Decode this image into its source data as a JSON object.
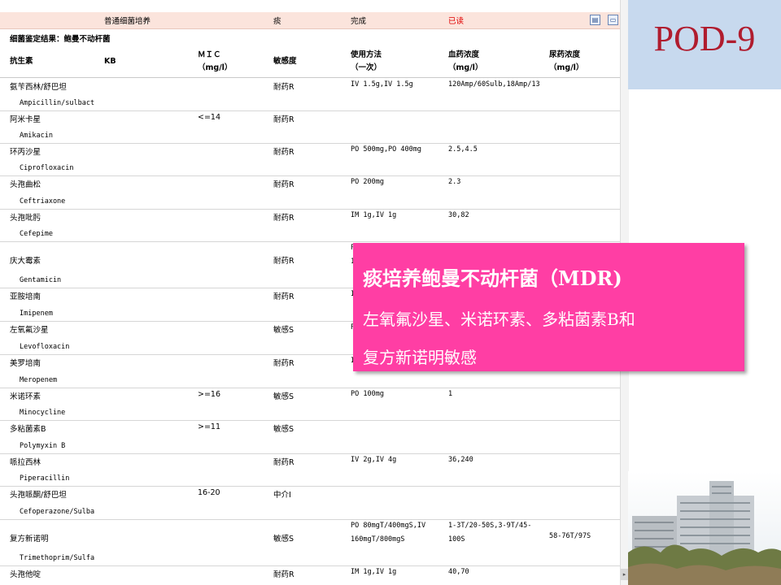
{
  "topbar": {
    "test": "普通细菌培养",
    "specimen": "痰",
    "status": "完成",
    "read_status": "已读"
  },
  "result_title": "细菌鉴定结果：鲍曼不动杆菌",
  "headers": {
    "antibiotic": "抗生素",
    "kb": "KB",
    "mic": "ＭＩＣ",
    "mic_unit": "（mg/l）",
    "sensitivity": "敏感度",
    "usage": "使用方法",
    "usage_sub": "（一次）",
    "blood": "血药浓度",
    "blood_unit": "（mg/l）",
    "urine": "尿药浓度",
    "urine_unit": "（mg/l）"
  },
  "rows": [
    {
      "cn": "氨苄西林/舒巴坦",
      "en": "Ampicillin/sulbact",
      "mic": "",
      "sens": "耐药R",
      "use": "IV 1.5g,IV 1.5g",
      "use2": "",
      "blood": "120Amp/60Sulb,18Amp/13",
      "blood2": "",
      "urine": ""
    },
    {
      "cn": "阿米卡星",
      "en": "Amikacin",
      "mic": "<=14",
      "sens": "耐药R",
      "use": "",
      "use2": "",
      "blood": "",
      "blood2": "",
      "urine": ""
    },
    {
      "cn": "环丙沙星",
      "en": "Ciprofloxacin",
      "mic": "",
      "sens": "耐药R",
      "use": "PO 500mg,PO 400mg",
      "use2": "",
      "blood": "2.5,4.5",
      "blood2": "",
      "urine": ""
    },
    {
      "cn": "头孢曲松",
      "en": "Ceftriaxone",
      "mic": "",
      "sens": "耐药R",
      "use": "PO 200mg",
      "use2": "",
      "blood": "2.3",
      "blood2": "",
      "urine": ""
    },
    {
      "cn": "头孢吡肟",
      "en": "Cefepime",
      "mic": "",
      "sens": "耐药R",
      "use": "IM 1g,IV 1g",
      "use2": "",
      "blood": "30,82",
      "blood2": "",
      "urine": ""
    },
    {
      "cn": "庆大霉素",
      "en": "Gentamicin",
      "mic": "",
      "sens": "耐药R",
      "use": "P",
      "use2": "1",
      "blood": "",
      "blood2": "",
      "urine": ""
    },
    {
      "cn": "亚胺培南",
      "en": "Imipenem",
      "mic": "",
      "sens": "耐药R",
      "use": "I",
      "use2": "",
      "blood": "",
      "blood2": "",
      "urine": ""
    },
    {
      "cn": "左氧氟沙星",
      "en": "Levofloxacin",
      "mic": "",
      "sens": "敏感S",
      "use": "P",
      "use2": "",
      "blood": "",
      "blood2": "",
      "urine": ""
    },
    {
      "cn": "美罗培南",
      "en": "Meropenem",
      "mic": "",
      "sens": "耐药R",
      "use": "I",
      "use2": "",
      "blood": "",
      "blood2": "",
      "urine": ""
    },
    {
      "cn": "米诺环素",
      "en": "Minocycline",
      "mic": ">=16",
      "sens": "敏感S",
      "use": "PO 100mg",
      "use2": "",
      "blood": "1",
      "blood2": "",
      "urine": ""
    },
    {
      "cn": "多粘菌素B",
      "en": "Polymyxin B",
      "mic": ">=11",
      "sens": "敏感S",
      "use": "",
      "use2": "",
      "blood": "",
      "blood2": "",
      "urine": ""
    },
    {
      "cn": "哌拉西林",
      "en": "Piperacillin",
      "mic": "",
      "sens": "耐药R",
      "use": "IV 2g,IV 4g",
      "use2": "",
      "blood": "36,240",
      "blood2": "",
      "urine": ""
    },
    {
      "cn": "头孢哌酮/舒巴坦",
      "en": "Cefoperazone/Sulba",
      "mic": "16-20",
      "sens": "中介I",
      "use": "",
      "use2": "",
      "blood": "",
      "blood2": "",
      "urine": ""
    },
    {
      "cn": "复方新诺明",
      "en": "Trimethoprim/Sulfa",
      "mic": "",
      "sens": "敏感S",
      "use": "PO 80mgT/400mgS,IV",
      "use2": "160mgT/800mgS",
      "blood": "1-3T/20-50S,3-9T/45-",
      "blood2": "100S",
      "urine": "58-76T/97S"
    },
    {
      "cn": "头孢他啶",
      "en": "",
      "mic": "",
      "sens": "耐药R",
      "use": "IM 1g,IV 1g",
      "use2": "",
      "blood": "40,70",
      "blood2": "",
      "urine": ""
    }
  ],
  "slide": {
    "title": "POD-9",
    "callout_title": "痰培养鲍曼不动杆菌（MDR)",
    "callout_line1": "左氧氟沙星、米诺环素、多粘菌素B和",
    "callout_line2": "复方新诺明敏感"
  },
  "icons": {
    "print": "print-icon",
    "collapse": "collapse-icon",
    "scroll": "scroll-arrow-icon"
  }
}
